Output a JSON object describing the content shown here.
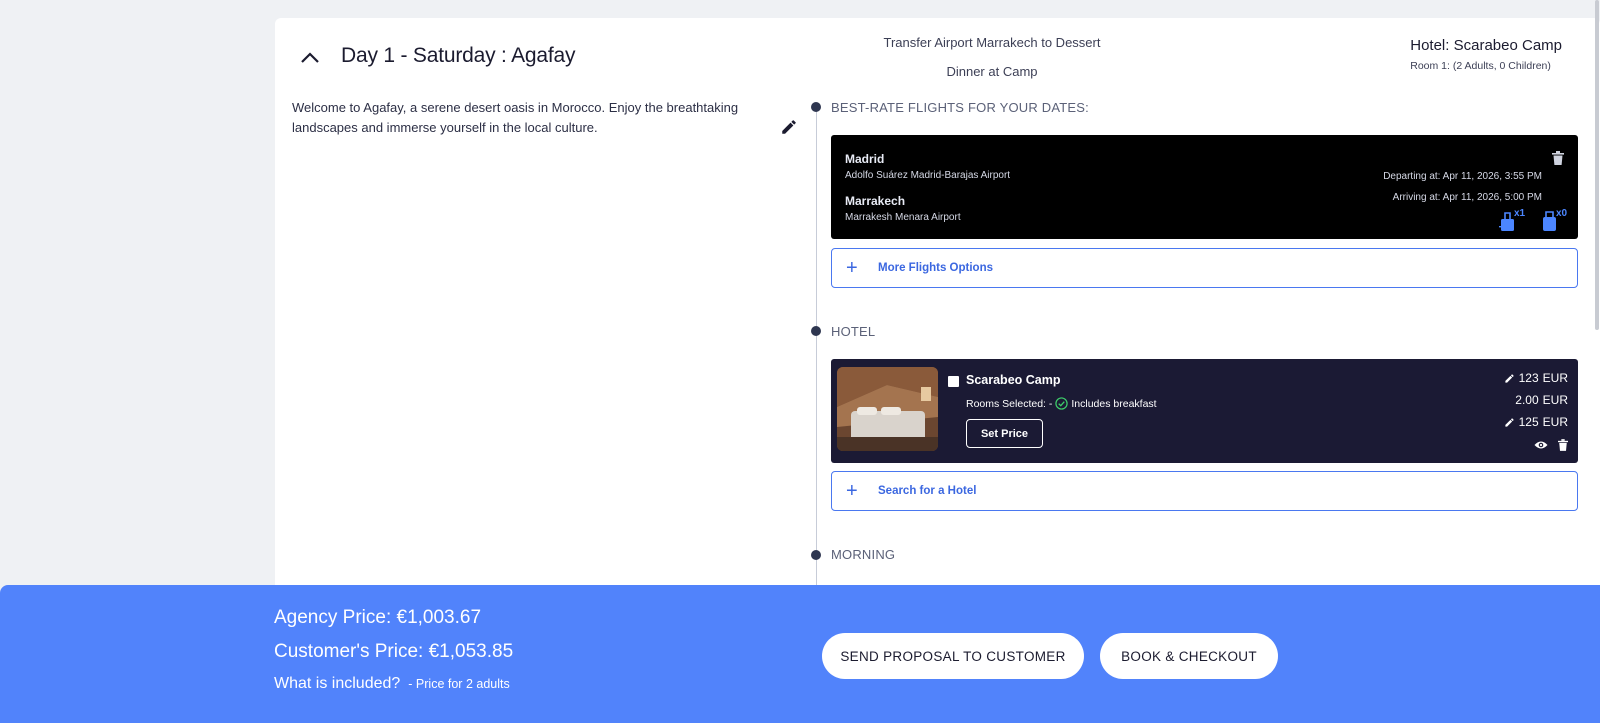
{
  "day": {
    "title": "Day 1 - Saturday : Agafay",
    "summary": [
      "Transfer Airport Marrakech to Dessert",
      "Dinner at Camp"
    ],
    "description": "Welcome to Agafay, a serene desert oasis in Morocco. Enjoy the breathtaking landscapes and immerse yourself in the local culture."
  },
  "hotel_header": {
    "title": "Hotel: Scarabeo Camp",
    "room": "Room 1: (2 Adults, 0 Children)"
  },
  "flights": {
    "section_label": "BEST-RATE FLIGHTS FOR YOUR DATES:",
    "origin_city": "Madrid",
    "origin_airport": "Adolfo Suárez Madrid-Barajas Airport",
    "destination_city": "Marrakech",
    "destination_airport": "Marrakesh Menara Airport",
    "departing": "Departing at: Apr 11, 2026, 3:55 PM",
    "arriving": "Arriving at: Apr 11, 2026, 5:00 PM",
    "cabin_bag_count": "x1",
    "checked_bag_count": "x0",
    "more_options_label": "More Flights Options"
  },
  "hotel": {
    "section_label": "HOTEL",
    "name": "Scarabeo Camp",
    "rooms_selected": "Rooms Selected: -",
    "includes": "Includes breakfast",
    "set_price_label": "Set Price",
    "price_1": "123",
    "price_2": "2.00",
    "price_3": "125",
    "currency": "EUR",
    "search_label": "Search for a Hotel"
  },
  "morning": {
    "section_label": "MORNING"
  },
  "footer": {
    "agency_price": "Agency Price: €1,003.67",
    "customer_price": "Customer's Price: €1,053.85",
    "included_label": "What is included?",
    "price_note": "- Price for 2 adults",
    "send_proposal_label": "SEND PROPOSAL TO CUSTOMER",
    "book_label": "BOOK & CHECKOUT"
  },
  "colors": {
    "accent": "#5183fb",
    "link": "#3b67e0",
    "flight_card": "#000000",
    "hotel_card": "#1b1a34",
    "baggage": "#4c86ff",
    "check_green": "#3ecf6b"
  }
}
